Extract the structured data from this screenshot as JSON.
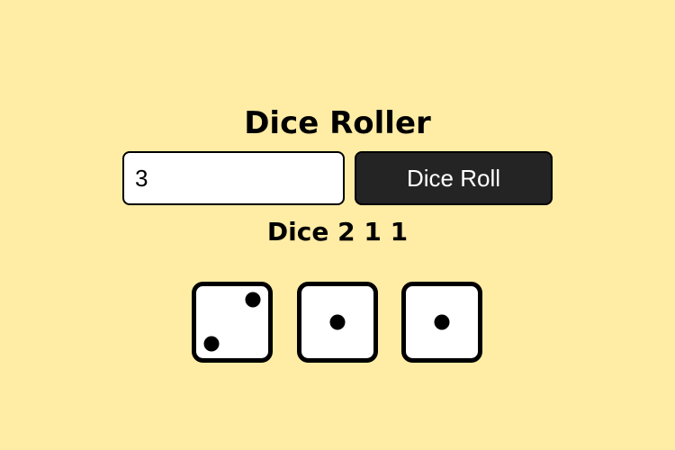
{
  "app": {
    "title": "Dice Roller"
  },
  "controls": {
    "count_value": "3",
    "roll_label": "Dice Roll"
  },
  "result": {
    "label": "Dice",
    "values": [
      "2",
      "1",
      "1"
    ]
  },
  "dice": [
    {
      "value": 2
    },
    {
      "value": 1
    },
    {
      "value": 1
    }
  ],
  "colors": {
    "background": "#FFECA5",
    "button": "#242424",
    "button_text": "#FFFFFF",
    "die_face": "#FFFFFF",
    "die_border": "#000000",
    "pip": "#000000"
  }
}
